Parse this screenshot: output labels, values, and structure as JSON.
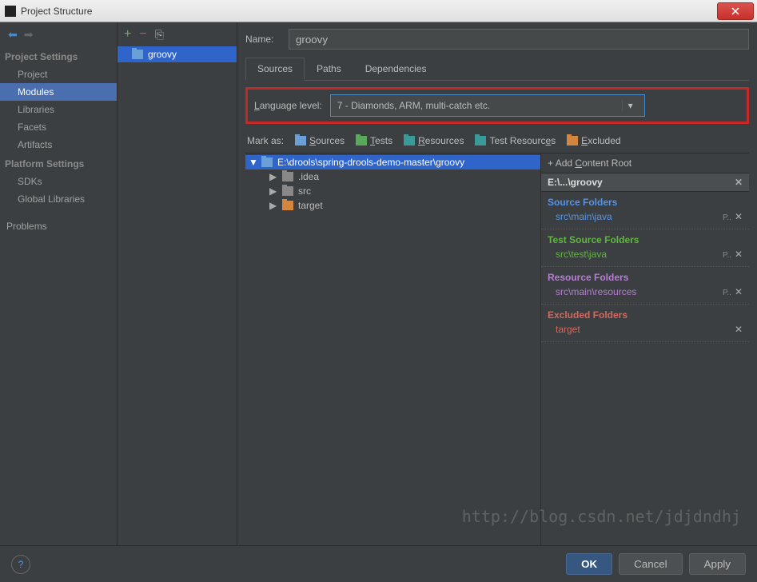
{
  "window": {
    "title": "Project Structure"
  },
  "sidebar": {
    "section1": "Project Settings",
    "items1": [
      "Project",
      "Modules",
      "Libraries",
      "Facets",
      "Artifacts"
    ],
    "selected": "Modules",
    "section2": "Platform Settings",
    "items2": [
      "SDKs",
      "Global Libraries"
    ],
    "problems": "Problems"
  },
  "modules": {
    "name": "groovy"
  },
  "main": {
    "name_label": "Name:",
    "name_value": "groovy",
    "tabs": [
      "Sources",
      "Paths",
      "Dependencies"
    ],
    "active_tab": "Sources",
    "lang_label": "Language level:",
    "lang_value": "7 - Diamonds, ARM, multi-catch etc.",
    "markas_label": "Mark as:",
    "mark_chips": [
      {
        "label": "Sources",
        "u": "S"
      },
      {
        "label": "Tests",
        "u": "T"
      },
      {
        "label": "Resources",
        "u": "R"
      },
      {
        "label": "Test Resources",
        "u": ""
      },
      {
        "label": "Excluded",
        "u": "E"
      }
    ],
    "tree": {
      "root": "E:\\drools\\spring-drools-demo-master\\groovy",
      "children": [
        ".idea",
        "src",
        "target"
      ]
    }
  },
  "roots": {
    "add_label": "Add Content Root",
    "path": "E:\\...\\groovy",
    "sections": [
      {
        "title": "Source Folders",
        "color": "blue",
        "items": [
          "src\\main\\java"
        ],
        "px": true
      },
      {
        "title": "Test Source Folders",
        "color": "green",
        "items": [
          "src\\test\\java"
        ],
        "px": true
      },
      {
        "title": "Resource Folders",
        "color": "purple",
        "items": [
          "src\\main\\resources"
        ],
        "px": true
      },
      {
        "title": "Excluded Folders",
        "color": "red",
        "items": [
          "target"
        ],
        "px": false
      }
    ]
  },
  "footer": {
    "ok": "OK",
    "cancel": "Cancel",
    "apply": "Apply"
  },
  "watermark": "http://blog.csdn.net/jdjdndhj"
}
